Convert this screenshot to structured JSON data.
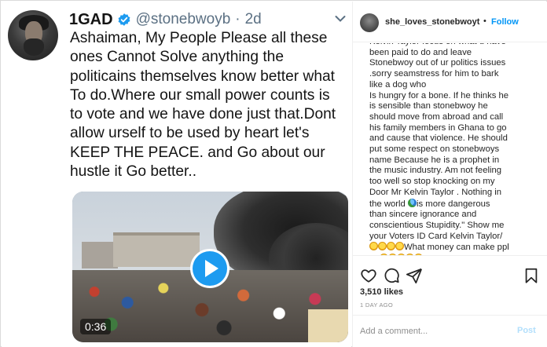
{
  "tweet": {
    "name": "1GAD",
    "handle": "@stonebwoyb",
    "separator": "·",
    "time": "2d",
    "text": "Ashaiman, My People Please all these\nones Cannot Solve anything the\npoliticains themselves know better what\nTo do.Where our small power counts is\nto vote and we have done just that.Dont\nallow urself to be used by heart let's\nKEEP THE PEACE. and Go about our\nhustle it Go better..",
    "video_duration": "0:36",
    "icons": {
      "verified": "verified-badge-icon",
      "more": "chevron-down-icon",
      "play": "play-icon"
    },
    "colors": {
      "accent": "#1d9bf0",
      "secondary_text": "#5b7083"
    }
  },
  "instagram": {
    "username": "she_loves_stonebwoyt",
    "dot": "•",
    "follow_label": "Follow",
    "caption_before_globe": "Kelvin Taylor focus on what u have\nbeen paid to do and leave\nStonebwoy out of ur politics issues\n.sorry seamstress for him to bark\nlike a dog who\nIs hungry for a bone. If he thinks he\nis sensible than stonebwoy he\nshould move from abroad and call\nhis family members in Ghana to go\nand cause that violence. He should\nput some respect on stonebwoys\nname Because he is a prophet in\nthe music industry. Am not feeling\ntoo well so stop knocking on my\nDoor Mr Kelvin Taylor . Nothing in\nthe world ",
    "caption_middle": "is more dangerous\nthan sincere ignorance and\nconscientious Stupidity.\" Show me\nyour Voters ID Card Kelvin Taylor/\n",
    "caption_after_laughs": "What money can make ppl\ndo",
    "likes": "3,510 likes",
    "date": "1 DAY AGO",
    "comment_placeholder": "Add a comment...",
    "post_label": "Post",
    "icons": {
      "like": "heart-icon",
      "comment": "comment-icon",
      "share": "paper-plane-icon",
      "save": "bookmark-icon",
      "globe_emoji": "globe-emoji",
      "laugh_emoji": "laughing-emoji"
    },
    "colors": {
      "follow": "#0095f6",
      "post_disabled": "#b2dffc",
      "muted": "#8e8e8e"
    }
  }
}
